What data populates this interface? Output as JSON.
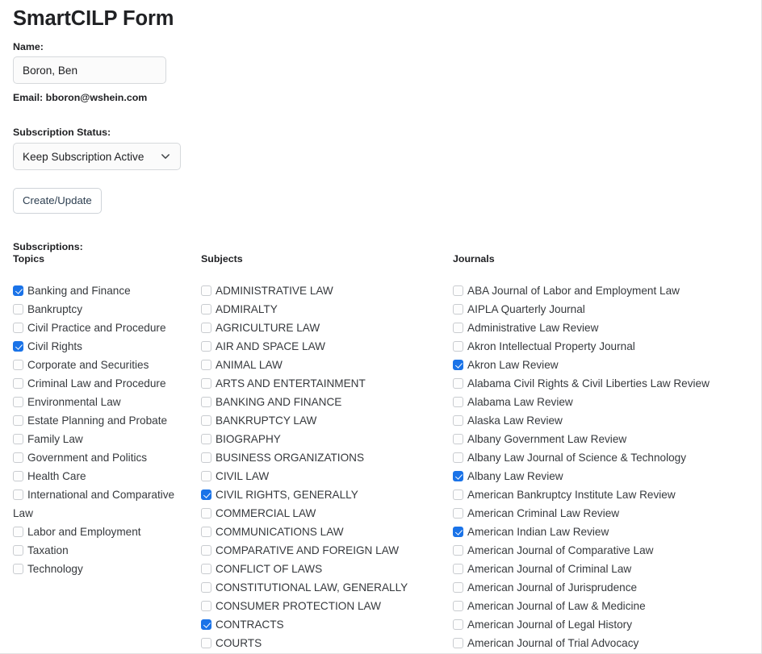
{
  "form": {
    "title": "SmartCILP Form",
    "name_label": "Name:",
    "name_value": "Boron, Ben",
    "name_placeholder": "",
    "email_line": "Email: bboron@wshein.com",
    "subscription_status_label": "Subscription Status:",
    "subscription_status_value": "Keep Subscription Active",
    "subscription_status_options": [
      "Keep Subscription Active"
    ],
    "create_update_label": "Create/Update",
    "subscriptions_label": "Subscriptions:",
    "chevron_icon": "chevron-down-icon"
  },
  "colors": {
    "accent": "#1a73e8",
    "text": "#202124",
    "item_text": "#36393d",
    "border": "#d6d9dc",
    "input_bg": "#fbfbfb"
  },
  "columns": {
    "topics": {
      "header": "Topics",
      "items": [
        {
          "label": "Banking and Finance",
          "checked": true
        },
        {
          "label": "Bankruptcy",
          "checked": false
        },
        {
          "label": "Civil Practice and Procedure",
          "checked": false
        },
        {
          "label": "Civil Rights",
          "checked": true
        },
        {
          "label": "Corporate and Securities",
          "checked": false
        },
        {
          "label": "Criminal Law and Procedure",
          "checked": false
        },
        {
          "label": "Environmental Law",
          "checked": false
        },
        {
          "label": "Estate Planning and Probate",
          "checked": false
        },
        {
          "label": "Family Law",
          "checked": false
        },
        {
          "label": "Government and Politics",
          "checked": false
        },
        {
          "label": "Health Care",
          "checked": false
        },
        {
          "label": "International and Comparative Law",
          "checked": false
        },
        {
          "label": "Labor and Employment",
          "checked": false
        },
        {
          "label": "Taxation",
          "checked": false
        },
        {
          "label": "Technology",
          "checked": false
        }
      ]
    },
    "subjects": {
      "header": "Subjects",
      "items": [
        {
          "label": "ADMINISTRATIVE LAW",
          "checked": false
        },
        {
          "label": "ADMIRALTY",
          "checked": false
        },
        {
          "label": "AGRICULTURE LAW",
          "checked": false
        },
        {
          "label": "AIR AND SPACE LAW",
          "checked": false
        },
        {
          "label": "ANIMAL LAW",
          "checked": false
        },
        {
          "label": "ARTS AND ENTERTAINMENT",
          "checked": false
        },
        {
          "label": "BANKING AND FINANCE",
          "checked": false
        },
        {
          "label": "BANKRUPTCY LAW",
          "checked": false
        },
        {
          "label": "BIOGRAPHY",
          "checked": false
        },
        {
          "label": "BUSINESS ORGANIZATIONS",
          "checked": false
        },
        {
          "label": "CIVIL LAW",
          "checked": false
        },
        {
          "label": "CIVIL RIGHTS, GENERALLY",
          "checked": true
        },
        {
          "label": "COMMERCIAL LAW",
          "checked": false
        },
        {
          "label": "COMMUNICATIONS LAW",
          "checked": false
        },
        {
          "label": "COMPARATIVE AND FOREIGN LAW",
          "checked": false
        },
        {
          "label": "CONFLICT OF LAWS",
          "checked": false
        },
        {
          "label": "CONSTITUTIONAL LAW, GENERALLY",
          "checked": false
        },
        {
          "label": "CONSUMER PROTECTION LAW",
          "checked": false
        },
        {
          "label": "CONTRACTS",
          "checked": true
        },
        {
          "label": "COURTS",
          "checked": false
        }
      ]
    },
    "journals": {
      "header": "Journals",
      "items": [
        {
          "label": "ABA Journal of Labor and Employment Law",
          "checked": false
        },
        {
          "label": "AIPLA Quarterly Journal",
          "checked": false
        },
        {
          "label": "Administrative Law Review",
          "checked": false
        },
        {
          "label": "Akron Intellectual Property Journal",
          "checked": false
        },
        {
          "label": "Akron Law Review",
          "checked": true
        },
        {
          "label": "Alabama Civil Rights & Civil Liberties Law Review",
          "checked": false
        },
        {
          "label": "Alabama Law Review",
          "checked": false
        },
        {
          "label": "Alaska Law Review",
          "checked": false
        },
        {
          "label": "Albany Government Law Review",
          "checked": false
        },
        {
          "label": "Albany Law Journal of Science & Technology",
          "checked": false
        },
        {
          "label": "Albany Law Review",
          "checked": true
        },
        {
          "label": "American Bankruptcy Institute Law Review",
          "checked": false
        },
        {
          "label": "American Criminal Law Review",
          "checked": false
        },
        {
          "label": "American Indian Law Review",
          "checked": true
        },
        {
          "label": "American Journal of Comparative Law",
          "checked": false
        },
        {
          "label": "American Journal of Criminal Law",
          "checked": false
        },
        {
          "label": "American Journal of Jurisprudence",
          "checked": false
        },
        {
          "label": "American Journal of Law & Medicine",
          "checked": false
        },
        {
          "label": "American Journal of Legal History",
          "checked": false
        },
        {
          "label": "American Journal of Trial Advocacy",
          "checked": false
        }
      ]
    }
  }
}
